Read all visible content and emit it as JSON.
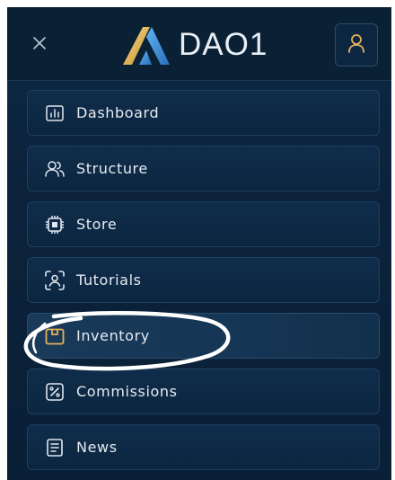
{
  "header": {
    "brand_name": "DAO1",
    "close_icon": "close-icon",
    "user_icon": "user-icon"
  },
  "menu": {
    "items": [
      {
        "label": "Dashboard",
        "icon": "chart-icon"
      },
      {
        "label": "Structure",
        "icon": "users-icon"
      },
      {
        "label": "Store",
        "icon": "chip-icon"
      },
      {
        "label": "Tutorials",
        "icon": "scan-user-icon"
      },
      {
        "label": "Inventory",
        "icon": "box-icon",
        "active": true
      },
      {
        "label": "Commissions",
        "icon": "percent-icon"
      },
      {
        "label": "News",
        "icon": "news-icon"
      }
    ]
  },
  "colors": {
    "panel_background": "#0b223a",
    "accent_gold": "#e4b15c",
    "logo_blue": "#3f8fd8",
    "text": "#e6ebf1"
  }
}
